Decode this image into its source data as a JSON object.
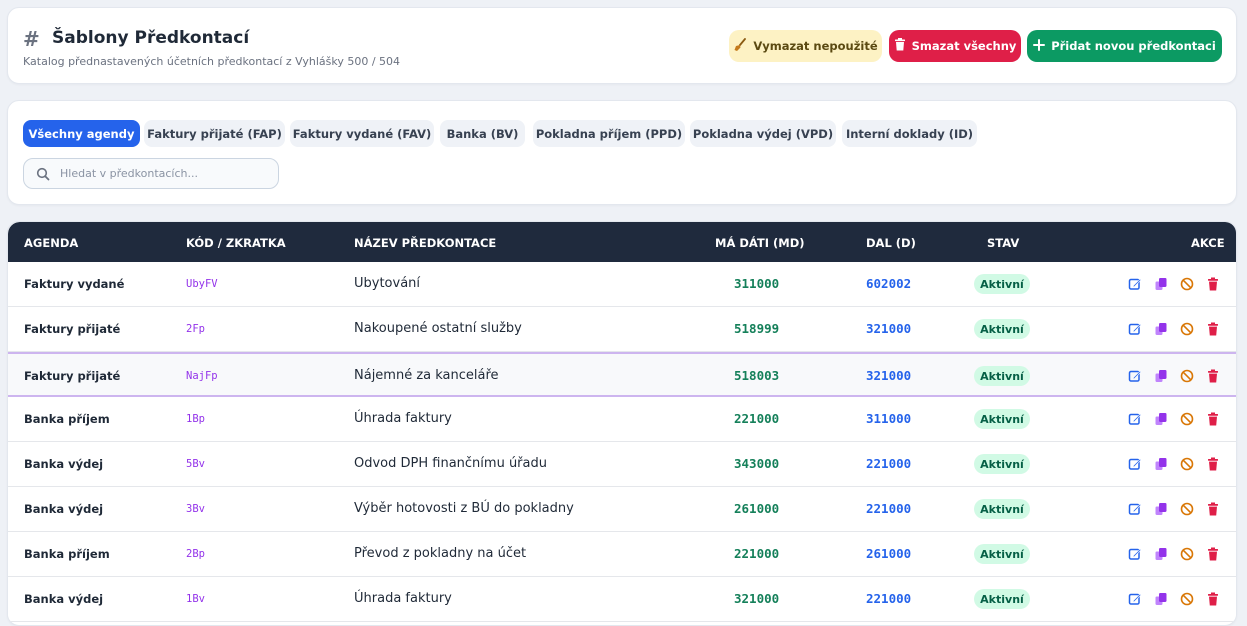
{
  "header": {
    "hash": "#",
    "title": "Šablony Předkontací",
    "subtitle": "Katalog přednastavených účetních předkontací z Vyhlášky 500 / 504",
    "btn_clear": "Vymazat nepoužité",
    "btn_delete_all": "Smazat všechny",
    "btn_add": "Přidat novou předkontaci"
  },
  "filters": {
    "tabs": [
      "Všechny agendy",
      "Faktury přijaté (FAP)",
      "Faktury vydané (FAV)",
      "Banka (BV)",
      "Pokladna příjem (PPD)",
      "Pokladna výdej (VPD)",
      "Interní doklady (ID)"
    ],
    "active_tab": 0,
    "search_placeholder": "Hledat v předkontacích...",
    "search_value": ""
  },
  "table": {
    "headers": {
      "agenda": "AGENDA",
      "code": "KÓD / ZKRATKA",
      "name": "NÁZEV PŘEDKONTACE",
      "md": "MÁ DÁTI (MD)",
      "dal": "DAL (D)",
      "status": "STAV",
      "actions": "AKCE"
    },
    "rows": [
      {
        "agenda": "Faktury vydané",
        "code": "UbyFV",
        "name": "Ubytování",
        "md": "311000",
        "dal": "602002",
        "status": "Aktivní"
      },
      {
        "agenda": "Faktury přijaté",
        "code": "2Fp",
        "name": "Nakoupené ostatní služby",
        "md": "518999",
        "dal": "321000",
        "status": "Aktivní"
      },
      {
        "agenda": "Faktury přijaté",
        "code": "NajFp",
        "name": "Nájemné za kanceláře",
        "md": "518003",
        "dal": "321000",
        "status": "Aktivní"
      },
      {
        "agenda": "Banka příjem",
        "code": "1Bp",
        "name": "Úhrada faktury",
        "md": "221000",
        "dal": "311000",
        "status": "Aktivní"
      },
      {
        "agenda": "Banka výdej",
        "code": "5Bv",
        "name": "Odvod DPH finančnímu úřadu",
        "md": "343000",
        "dal": "221000",
        "status": "Aktivní"
      },
      {
        "agenda": "Banka výdej",
        "code": "3Bv",
        "name": "Výběr hotovosti z BÚ do pokladny",
        "md": "261000",
        "dal": "221000",
        "status": "Aktivní"
      },
      {
        "agenda": "Banka příjem",
        "code": "2Bp",
        "name": "Převod z pokladny na účet",
        "md": "221000",
        "dal": "261000",
        "status": "Aktivní"
      },
      {
        "agenda": "Banka výdej",
        "code": "1Bv",
        "name": "Úhrada faktury",
        "md": "321000",
        "dal": "221000",
        "status": "Aktivní"
      }
    ],
    "highlighted_row": 2,
    "row_actions": [
      "edit-icon",
      "copy-icon",
      "disable-icon",
      "trash-icon"
    ]
  },
  "colors": {
    "primary": "#2563eb",
    "danger": "#df1f48",
    "success": "#0c9a63",
    "warning_bg": "#fdf2c4",
    "header_dark": "#1f2a3d",
    "code_purple": "#9333ea",
    "md_green": "#15805a"
  }
}
